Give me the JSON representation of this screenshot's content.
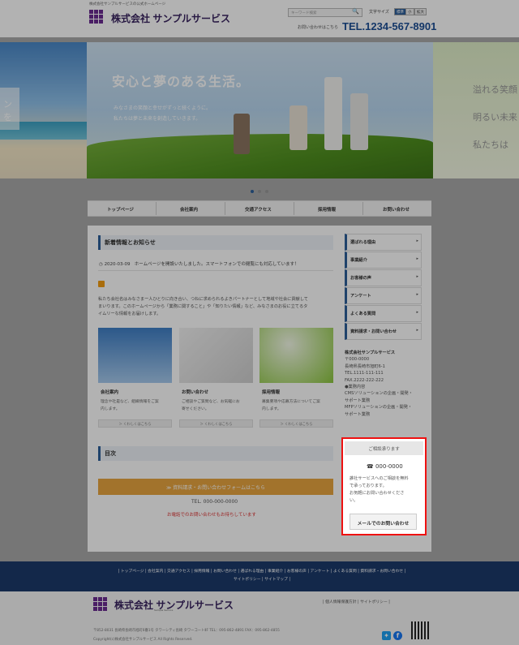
{
  "topline": "株式会社サンプルサービスの公式ホームページ",
  "header": {
    "logo_text": "株式会社 サンプルサービス",
    "search_placeholder": "キーワード検索",
    "fontsize_label": "文字サイズ",
    "fontsize_options": [
      "標準",
      "小",
      "拡大"
    ],
    "contact_small": "お問い合わせはこちら",
    "tel": "TEL.1234-567-8901"
  },
  "hero": {
    "left_tab": "ンを",
    "title": "安心と夢のある生活。",
    "sub_line1": "みなさまの笑顔と幸せがずっと続くように。",
    "sub_line2": "私たちは夢と未来を創造していきます。",
    "right_line1": "溢れる笑顔",
    "right_line2": "明るい未来",
    "right_line3": "私たちは"
  },
  "nav": {
    "items": [
      "トップページ",
      "会社案内",
      "交通アクセス",
      "採用情報",
      "お問い合わせ"
    ]
  },
  "main": {
    "news_heading": "新着情報とお知らせ",
    "news_date": "2020-03-09",
    "news_text": "ホームページを開設いたしました。スマートフォンでの閲覧にも対応しています！",
    "intro_line1": "私たち会社名はみなさまー人ひとりに向き合い、つねに求められるよきパートナーとして地域や社会に貢献して",
    "intro_line2": "まいります。このホームページから「業務に関すること」や「知りたい情報」など、みなさまのお役に立てるタ",
    "intro_line3": "イムリーな情報をお届けします。",
    "cards": [
      {
        "title": "会社案内",
        "text1": "理念や社是など、組織情報をご案",
        "text2": "内します。",
        "button": "＞ くわしくはこちら"
      },
      {
        "title": "お問い合わせ",
        "text1": "ご相談やご質問など、お気軽にお",
        "text2": "寄せください。",
        "button": "＞ くわしくはこちら"
      },
      {
        "title": "採用情報",
        "text1": "募集要項や応募方法についてご案",
        "text2": "内します。",
        "button": "＞ くわしくはこちら"
      }
    ],
    "toc_heading": "目次",
    "doc_button": "≫ 資料請求・お問い合わせフォームはこちら",
    "tel": "TEL. 000-000-0000",
    "note": "お電話でのお問い合わせもお待ちしています"
  },
  "sidebar": {
    "items": [
      "選ばれる理由",
      "事業紹介",
      "お客様の声",
      "アンケート",
      "よくある質問",
      "資料請求・お問い合わせ"
    ],
    "company_lines": [
      "株式会社サンプルサービス",
      "〒000-0000",
      "長崎県長崎市旭町6-1",
      "TEL.1111-111-111",
      "FAX.2222-222-222",
      "●業務内容",
      "CMSソリューションの企画・開発・",
      "サポート業務",
      "MFPソリューションの企画・開発・",
      "サポート業務"
    ],
    "consult_heading": "ご相談承ります",
    "consult_tel": "000-0000",
    "consult_text1": "誰社サービスへのご相談を無料",
    "consult_text2": "で承っております。",
    "consult_text3": "お気軽にお問い合わせくださ",
    "consult_text4": "い。",
    "mail_button": "メールでのお問い合わせ"
  },
  "footer": {
    "links_line1": "| トップページ | 会社案内 | 交通アクセス | 採用情報 | お問い合わせ | 選ばれる理由 | 事業紹介 | お客様の声 | アンケート | よくある質問 | 資料請求・お問い合わせ |",
    "links_line2": "サイトポリシー | サイトマップ |",
    "logo_text": "株式会社 サンプルサービス",
    "logo_sub": "Sample Service",
    "side_links": "| 個人情報保護方針 | サイトポリシー |",
    "address": "〒852-8031 長崎県長崎市旭町6番1号 タワーシティ長崎 タワーコートⅡF TEL：095-862-4891 FAX：095-862-4855",
    "copyright": "Copyright(c)株式会社サンプルサービス All Rights Reserved."
  },
  "colors": {
    "accent": "#1d4f96",
    "brand": "#3a2560",
    "orange": "#e8a53f",
    "highlight": "#e11111"
  }
}
